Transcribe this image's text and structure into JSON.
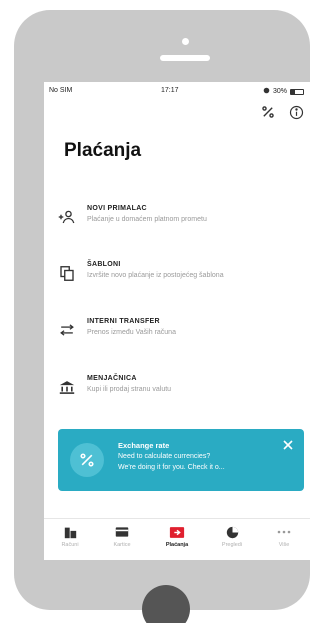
{
  "status_bar": {
    "carrier": "No SIM",
    "time": "17:17",
    "battery_percent": "30%",
    "battery_level": 0.3
  },
  "header": {
    "title": "Plaćanja"
  },
  "top_icons": [
    "exchange-icon",
    "info-icon"
  ],
  "menu": [
    {
      "title": "NOVI PRIMALAC",
      "subtitle": "Plaćanje u domaćem platnom prometu",
      "icon": "add-user-icon"
    },
    {
      "title": "ŠABLONI",
      "subtitle": "Izvršite novo plaćanje iz postojećeg šablona",
      "icon": "copy-icon"
    },
    {
      "title": "INTERNI TRANSFER",
      "subtitle": "Prenos između Vaših računa",
      "icon": "transfer-arrows-icon"
    },
    {
      "title": "MENJAČNICA",
      "subtitle": "Kupi ili prodaj stranu valutu",
      "icon": "bank-icon"
    }
  ],
  "banner": {
    "title": "Exchange rate",
    "line1": "Need to calculate currencies?",
    "line2": "We're doing it for you. Check it o...",
    "color": "#2aabc3"
  },
  "tabs": [
    {
      "label": "Računi",
      "icon": "accounts-icon",
      "active": false
    },
    {
      "label": "Kartice",
      "icon": "card-icon",
      "active": false
    },
    {
      "label": "Plaćanja",
      "icon": "payment-icon",
      "active": true
    },
    {
      "label": "Pregledi",
      "icon": "chart-icon",
      "active": false
    },
    {
      "label": "Više",
      "icon": "more-icon",
      "active": false
    }
  ],
  "colors": {
    "accent": "#e0202f",
    "banner": "#2aabc3"
  }
}
